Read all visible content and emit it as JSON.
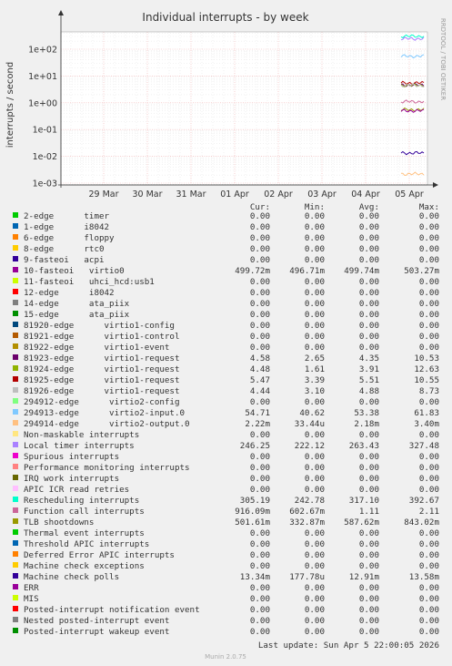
{
  "chart_data": {
    "type": "line",
    "title": "Individual interrupts - by week",
    "ylabel": "interrupts / second",
    "side_label": "RRDTOOL / TOBI OETIKER",
    "y_scale": "log",
    "ylim": [
      0.001,
      300
    ],
    "y_ticks": [
      "1e+02",
      "1e+01",
      "1e+00",
      "1e-01",
      "1e-02",
      "1e-03"
    ],
    "x_ticks": [
      "29 Mar",
      "30 Mar",
      "31 Mar",
      "01 Apr",
      "02 Apr",
      "03 Apr",
      "04 Apr",
      "05 Apr"
    ],
    "grid": true,
    "columns": [
      "Cur:",
      "Min:",
      "Avg:",
      "Max:"
    ],
    "series": [
      {
        "name": "2-edge      timer",
        "color": "#00cc00",
        "values": [
          "0.00",
          "0.00",
          "0.00",
          "0.00"
        ]
      },
      {
        "name": "1-edge      i8042",
        "color": "#0066b3",
        "values": [
          "0.00",
          "0.00",
          "0.00",
          "0.00"
        ]
      },
      {
        "name": "6-edge      floppy",
        "color": "#ff8000",
        "values": [
          "0.00",
          "0.00",
          "0.00",
          "0.00"
        ]
      },
      {
        "name": "8-edge      rtc0",
        "color": "#ffcc00",
        "values": [
          "0.00",
          "0.00",
          "0.00",
          "0.00"
        ]
      },
      {
        "name": "9-fasteoi   acpi",
        "color": "#330099",
        "values": [
          "0.00",
          "0.00",
          "0.00",
          "0.00"
        ]
      },
      {
        "name": "10-fasteoi   virtio0",
        "color": "#990099",
        "values": [
          "499.72m",
          "496.71m",
          "499.74m",
          "503.27m"
        ]
      },
      {
        "name": "11-fasteoi   uhci_hcd:usb1",
        "color": "#ccff00",
        "values": [
          "0.00",
          "0.00",
          "0.00",
          "0.00"
        ]
      },
      {
        "name": "12-edge      i8042",
        "color": "#ff0000",
        "values": [
          "0.00",
          "0.00",
          "0.00",
          "0.00"
        ]
      },
      {
        "name": "14-edge      ata_piix",
        "color": "#808080",
        "values": [
          "0.00",
          "0.00",
          "0.00",
          "0.00"
        ]
      },
      {
        "name": "15-edge      ata_piix",
        "color": "#008f00",
        "values": [
          "0.00",
          "0.00",
          "0.00",
          "0.00"
        ]
      },
      {
        "name": "81920-edge      virtio1-config",
        "color": "#00487d",
        "values": [
          "0.00",
          "0.00",
          "0.00",
          "0.00"
        ]
      },
      {
        "name": "81921-edge      virtio1-control",
        "color": "#b35a00",
        "values": [
          "0.00",
          "0.00",
          "0.00",
          "0.00"
        ]
      },
      {
        "name": "81922-edge      virtio1-event",
        "color": "#b38f00",
        "values": [
          "0.00",
          "0.00",
          "0.00",
          "0.00"
        ]
      },
      {
        "name": "81923-edge      virtio1-request",
        "color": "#6b006b",
        "values": [
          "4.58",
          "2.65",
          "4.35",
          "10.53"
        ]
      },
      {
        "name": "81924-edge      virtio1-request",
        "color": "#8fb300",
        "values": [
          "4.48",
          "1.61",
          "3.91",
          "12.63"
        ]
      },
      {
        "name": "81925-edge      virtio1-request",
        "color": "#b30000",
        "values": [
          "5.47",
          "3.39",
          "5.51",
          "10.55"
        ]
      },
      {
        "name": "81926-edge      virtio1-request",
        "color": "#bebebe",
        "values": [
          "4.44",
          "3.10",
          "4.88",
          "8.73"
        ]
      },
      {
        "name": "294912-edge      virtio2-config",
        "color": "#80ff80",
        "values": [
          "0.00",
          "0.00",
          "0.00",
          "0.00"
        ]
      },
      {
        "name": "294913-edge      virtio2-input.0",
        "color": "#80c9ff",
        "values": [
          "54.71",
          "40.62",
          "53.38",
          "61.83"
        ]
      },
      {
        "name": "294914-edge      virtio2-output.0",
        "color": "#ffc080",
        "values": [
          "2.22m",
          "33.44u",
          "2.18m",
          "3.40m"
        ]
      },
      {
        "name": "Non-maskable interrupts",
        "color": "#ffe680",
        "values": [
          "0.00",
          "0.00",
          "0.00",
          "0.00"
        ]
      },
      {
        "name": "Local timer interrupts",
        "color": "#aa80ff",
        "values": [
          "246.25",
          "222.12",
          "263.43",
          "327.48"
        ]
      },
      {
        "name": "Spurious interrupts",
        "color": "#ee00cc",
        "values": [
          "0.00",
          "0.00",
          "0.00",
          "0.00"
        ]
      },
      {
        "name": "Performance monitoring interrupts",
        "color": "#ff8080",
        "values": [
          "0.00",
          "0.00",
          "0.00",
          "0.00"
        ]
      },
      {
        "name": "IRQ work interrupts",
        "color": "#666600",
        "values": [
          "0.00",
          "0.00",
          "0.00",
          "0.00"
        ]
      },
      {
        "name": "APIC ICR read retries",
        "color": "#ffbfff",
        "values": [
          "0.00",
          "0.00",
          "0.00",
          "0.00"
        ]
      },
      {
        "name": "Rescheduling interrupts",
        "color": "#00ffcc",
        "values": [
          "305.19",
          "242.78",
          "317.10",
          "392.67"
        ]
      },
      {
        "name": "Function call interrupts",
        "color": "#cc6699",
        "values": [
          "916.09m",
          "602.67m",
          "1.11",
          "2.11"
        ]
      },
      {
        "name": "TLB shootdowns",
        "color": "#999900",
        "values": [
          "501.61m",
          "332.87m",
          "587.62m",
          "843.02m"
        ]
      },
      {
        "name": "Thermal event interrupts",
        "color": "#00cc00",
        "values": [
          "0.00",
          "0.00",
          "0.00",
          "0.00"
        ]
      },
      {
        "name": "Threshold APIC interrupts",
        "color": "#0066b3",
        "values": [
          "0.00",
          "0.00",
          "0.00",
          "0.00"
        ]
      },
      {
        "name": "Deferred Error APIC interrupts",
        "color": "#ff8000",
        "values": [
          "0.00",
          "0.00",
          "0.00",
          "0.00"
        ]
      },
      {
        "name": "Machine check exceptions",
        "color": "#ffcc00",
        "values": [
          "0.00",
          "0.00",
          "0.00",
          "0.00"
        ]
      },
      {
        "name": "Machine check polls",
        "color": "#330099",
        "values": [
          "13.34m",
          "177.78u",
          "12.91m",
          "13.58m"
        ]
      },
      {
        "name": "ERR",
        "color": "#990099",
        "values": [
          "0.00",
          "0.00",
          "0.00",
          "0.00"
        ]
      },
      {
        "name": "MIS",
        "color": "#ccff00",
        "values": [
          "0.00",
          "0.00",
          "0.00",
          "0.00"
        ]
      },
      {
        "name": "Posted-interrupt notification event",
        "color": "#ff0000",
        "values": [
          "0.00",
          "0.00",
          "0.00",
          "0.00"
        ]
      },
      {
        "name": "Nested posted-interrupt event",
        "color": "#808080",
        "values": [
          "0.00",
          "0.00",
          "0.00",
          "0.00"
        ]
      },
      {
        "name": "Posted-interrupt wakeup event",
        "color": "#008f00",
        "values": [
          "0.00",
          "0.00",
          "0.00",
          "0.00"
        ]
      }
    ],
    "plot_lines": [
      {
        "color": "#00ffcc",
        "value": 305
      },
      {
        "color": "#aa80ff",
        "value": 246
      },
      {
        "color": "#80c9ff",
        "value": 54.7
      },
      {
        "color": "#b30000",
        "value": 5.47
      },
      {
        "color": "#6b006b",
        "value": 4.58
      },
      {
        "color": "#8fb300",
        "value": 4.48
      },
      {
        "color": "#bebebe",
        "value": 4.44
      },
      {
        "color": "#cc6699",
        "value": 1.1
      },
      {
        "color": "#999900",
        "value": 0.55
      },
      {
        "color": "#990099",
        "value": 0.5
      },
      {
        "color": "#330099",
        "value": 0.0133
      },
      {
        "color": "#ffc080",
        "value": 0.0022
      }
    ],
    "last_update": "Last update: Sun Apr  5 22:00:05 2026",
    "footer": "Munin 2.0.75"
  }
}
